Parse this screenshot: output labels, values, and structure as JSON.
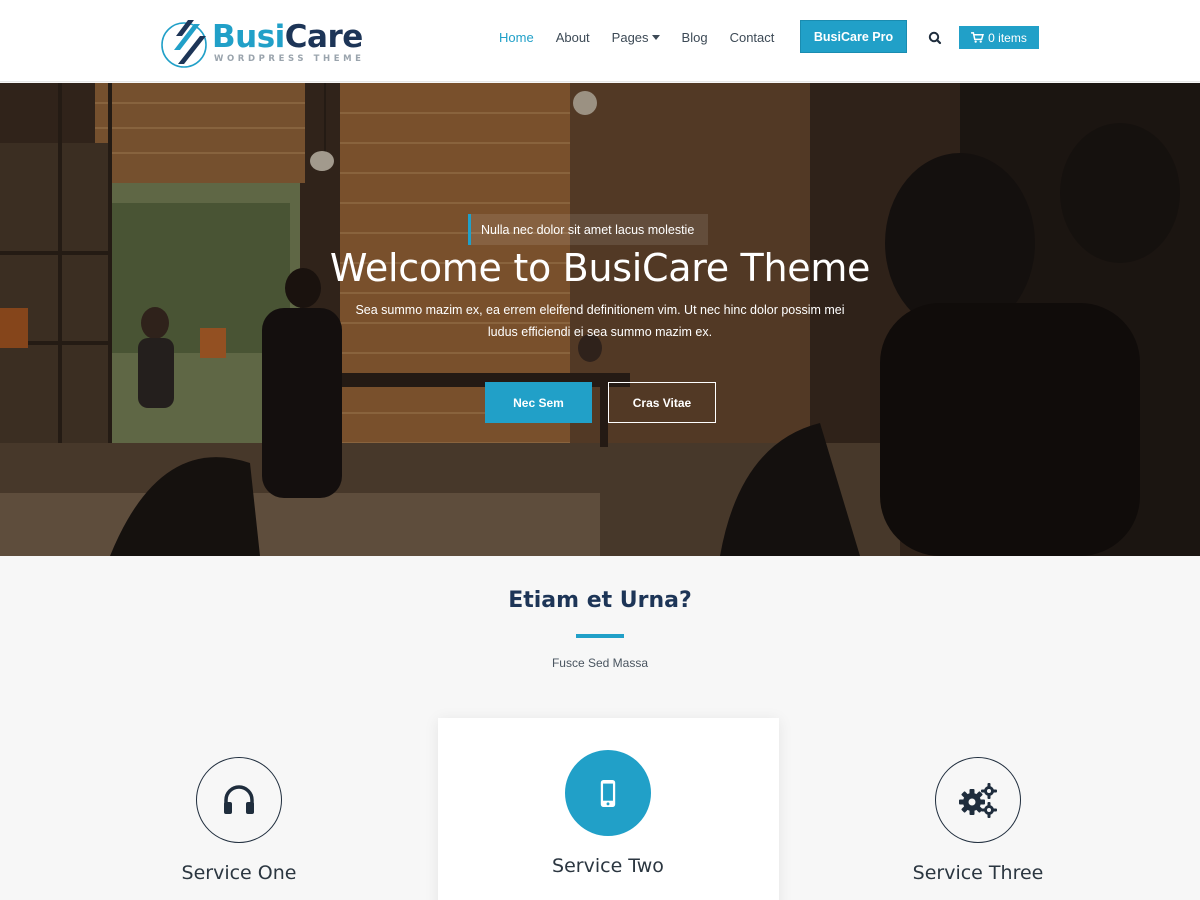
{
  "brand": {
    "name_part1": "Busi",
    "name_part2": "Care",
    "tagline": "WORDPRESS THEME"
  },
  "nav": {
    "items": [
      {
        "label": "Home",
        "active": true
      },
      {
        "label": "About",
        "active": false
      },
      {
        "label": "Pages",
        "active": false,
        "dropdown": true
      },
      {
        "label": "Blog",
        "active": false
      },
      {
        "label": "Contact",
        "active": false
      }
    ],
    "pro_button": "BusiCare Pro",
    "search_icon": "search-icon",
    "cart_label": "0 items",
    "cart_icon": "cart-icon"
  },
  "hero": {
    "tagline": "Nulla nec dolor sit amet lacus molestie",
    "title": "Welcome to BusiCare Theme",
    "description": "Sea summo mazim ex, ea errem eleifend definitionem vim. Ut nec hinc dolor possim mei ludus efficiendi ei sea summo mazim ex.",
    "primary_button": "Nec Sem",
    "secondary_button": "Cras Vitae"
  },
  "services": {
    "title": "Etiam et Urna?",
    "subtitle": "Fusce Sed Massa",
    "items": [
      {
        "name": "Service One",
        "icon": "headphones-icon"
      },
      {
        "name": "Service Two",
        "icon": "mobile-phone-icon"
      },
      {
        "name": "Service Three",
        "icon": "gears-icon"
      }
    ]
  },
  "colors": {
    "accent": "#21a0c8",
    "dark": "#1d3557",
    "background": "#f7f7f7"
  }
}
